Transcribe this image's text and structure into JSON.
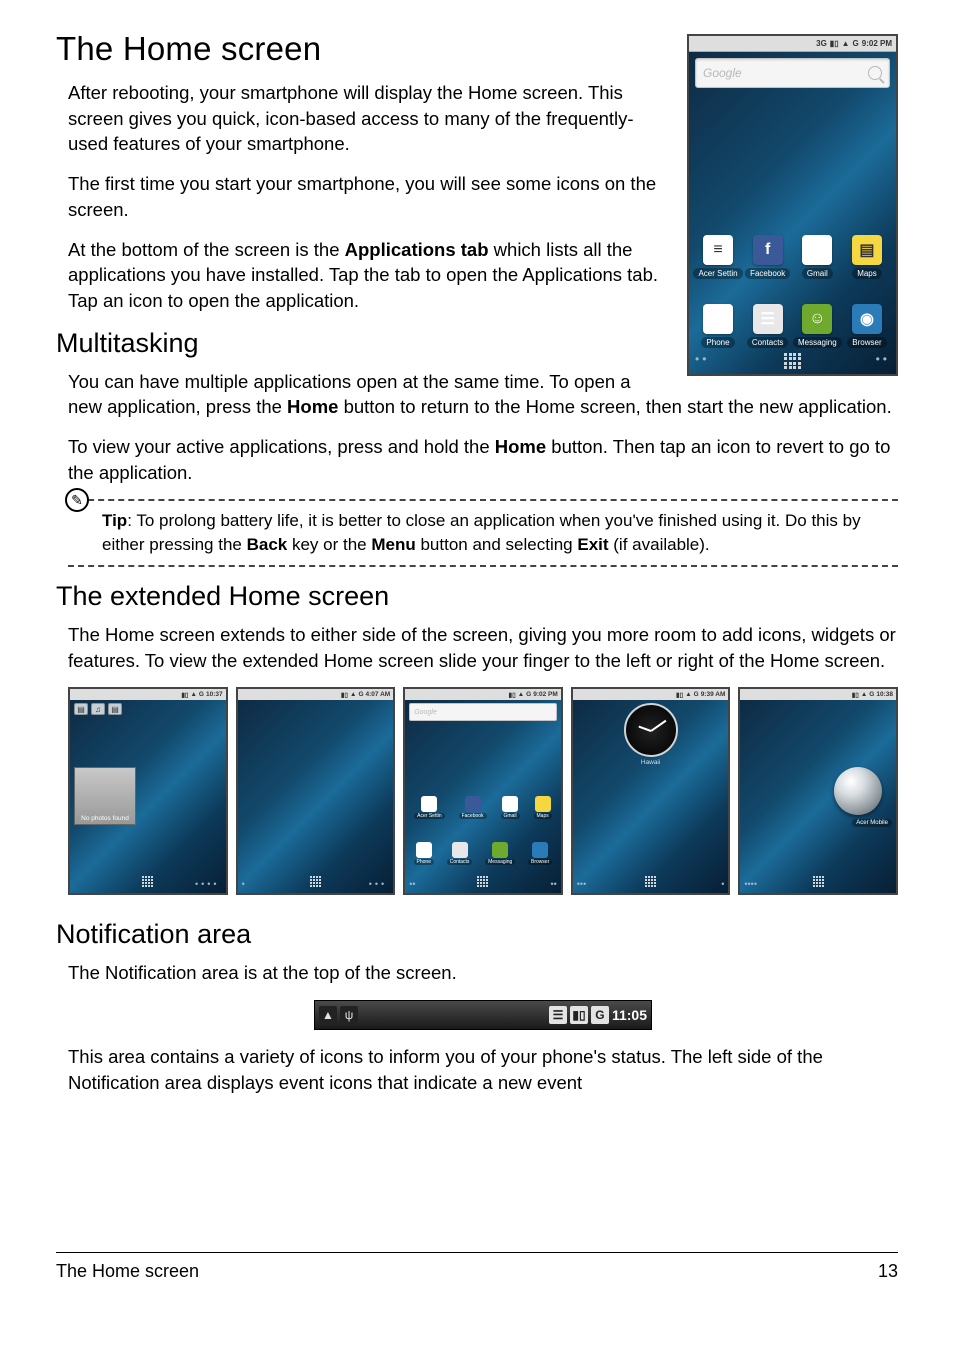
{
  "heading1": "The Home screen",
  "para1": "After rebooting, your smartphone will display the Home screen. This screen gives you quick, icon-based access to many of the frequently-used features of your smartphone.",
  "para2": "The first time you start your smartphone, you will see some icons on the screen.",
  "para3_a": "At the bottom of the screen is the ",
  "para3_b": "Applications tab",
  "para3_c": " which lists all the applications you have installed. Tap the tab to open the Applications tab. Tap an icon to open the application.",
  "heading2": "Multitasking",
  "para4_a": "You can have multiple applications open at the same time. To open a new application, press the ",
  "para4_b": "Home",
  "para4_c": " button to return to the Home screen, then start the new application.",
  "para5_a": "To view your active applications, press and hold the ",
  "para5_b": "Home",
  "para5_c": " button. Then tap an icon to revert to go to the application.",
  "tip_label": "Tip",
  "tip_a": ": To prolong battery life, it is better to close an application when you've finished using it. Do this by either pressing the ",
  "tip_b": "Back",
  "tip_c": " key or the ",
  "tip_d": "Menu",
  "tip_e": " button and selecting ",
  "tip_f": "Exit",
  "tip_g": " (if available).",
  "heading3": "The extended Home screen",
  "para6": "The Home screen extends to either side of the screen, giving you more room to add icons, widgets or features. To view the extended Home screen slide your finger to the left or right of the Home screen.",
  "heading4": "Notification area",
  "para7": "The Notification area is at the top of the screen.",
  "para8": "This area contains a variety of icons to inform you of your phone's status. The left side of the Notification area displays event icons that indicate a new event",
  "footer_title": "The Home screen",
  "page_number": "13",
  "phone_large": {
    "status_time": "9:02 PM",
    "status_icons": [
      "3G",
      "▮▯",
      "▲",
      "G"
    ],
    "search_placeholder": "Google",
    "row1": [
      {
        "label": "Acer Settin",
        "glyph": "≡",
        "cls": "ic-bg-wh"
      },
      {
        "label": "Facebook",
        "glyph": "f",
        "cls": "ic-bg-fb"
      },
      {
        "label": "Gmail",
        "glyph": "M",
        "cls": "ic-bg-gm"
      },
      {
        "label": "Maps",
        "glyph": "▤",
        "cls": "ic-bg-mp"
      }
    ],
    "row2": [
      {
        "label": "Phone",
        "glyph": "✆",
        "cls": "ic-bg-ph"
      },
      {
        "label": "Contacts",
        "glyph": "☰",
        "cls": "ic-bg-ct"
      },
      {
        "label": "Messaging",
        "glyph": "☺",
        "cls": "ic-bg-ms"
      },
      {
        "label": "Browser",
        "glyph": "◉",
        "cls": "ic-bg-br"
      }
    ]
  },
  "screens": {
    "times": [
      "10:37",
      "4:07 AM",
      "9:02 PM",
      "9:39 AM",
      "10:38"
    ],
    "photo_label": "No photos found",
    "search_placeholder": "Google",
    "row1": [
      {
        "label": "Acer Settin",
        "cls": "ic-bg-wh"
      },
      {
        "label": "Facebook",
        "cls": "ic-bg-fb"
      },
      {
        "label": "Gmail",
        "cls": "ic-bg-gm"
      },
      {
        "label": "Maps",
        "cls": "ic-bg-mp"
      }
    ],
    "row2": [
      {
        "label": "Phone",
        "cls": "ic-bg-ph"
      },
      {
        "label": "Contacts",
        "cls": "ic-bg-ct"
      },
      {
        "label": "Messaging",
        "cls": "ic-bg-ms"
      },
      {
        "label": "Browser",
        "cls": "ic-bg-br"
      }
    ],
    "clock_label": "Hawaii",
    "globe_label": "Acer Mobile"
  },
  "notification_bar": {
    "time": "11:05",
    "left_icons": [
      "▲",
      "ψ"
    ],
    "right_icons": [
      "☰",
      "▮▯",
      "G"
    ]
  }
}
